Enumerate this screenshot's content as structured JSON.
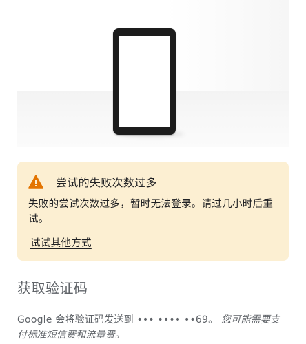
{
  "warning": {
    "title": "尝试的失败次数过多",
    "body": "失败的尝试次数过多，暂时无法登录。请过几小时后重试。",
    "link": "试试其他方式",
    "icon": "warning-triangle-icon",
    "background_color": "#fcefd2",
    "icon_color": "#e37400"
  },
  "section": {
    "title": "获取验证码",
    "description_prefix": "Google 会将验证码发送到 ••• •••• ••69。",
    "description_italic": "您可能需要支付标准短信费和流量费。"
  }
}
